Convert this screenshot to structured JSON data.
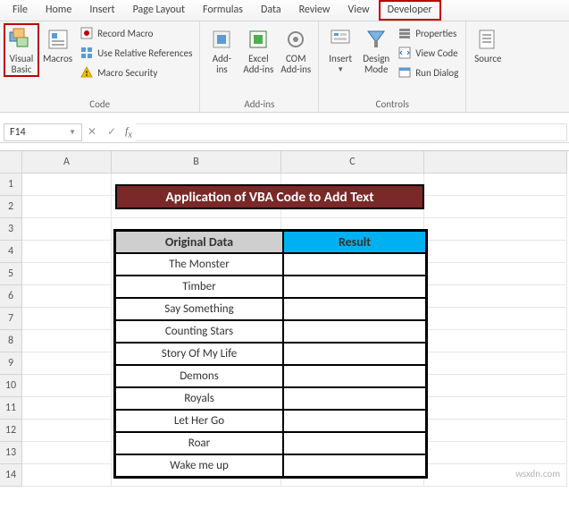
{
  "tabs": {
    "file": "File",
    "home": "Home",
    "insert": "Insert",
    "pagelayout": "Page Layout",
    "formulas": "Formulas",
    "data": "Data",
    "review": "Review",
    "view": "View",
    "developer": "Developer"
  },
  "ribbon": {
    "code": {
      "vb": "Visual\nBasic",
      "macros": "Macros",
      "record": "Record Macro",
      "relref": "Use Relative References",
      "security": "Macro Security",
      "group": "Code"
    },
    "addins": {
      "addins": "Add-\nins",
      "excel": "Excel\nAdd-ins",
      "com": "COM\nAdd-ins",
      "group": "Add-ins"
    },
    "controls": {
      "insert": "Insert",
      "design": "Design\nMode",
      "properties": "Properties",
      "viewcode": "View Code",
      "rundialog": "Run Dialog",
      "group": "Controls"
    },
    "xml": {
      "source": "Source"
    }
  },
  "namebox": "F14",
  "columns": [
    "A",
    "B",
    "C"
  ],
  "rows": [
    "1",
    "2",
    "3",
    "4",
    "5",
    "6",
    "7",
    "8",
    "9",
    "10",
    "11",
    "12",
    "13",
    "14"
  ],
  "sheet": {
    "title": "Application of VBA Code to Add Text",
    "headers": {
      "col1": "Original Data",
      "col2": "Result"
    },
    "data": [
      "The Monster",
      "Timber",
      "Say Something",
      "Counting Stars",
      "Story Of My Life",
      "Demons",
      "Royals",
      "Let Her Go",
      "Roar",
      "Wake me up"
    ]
  },
  "watermark": "wsxdn.com"
}
